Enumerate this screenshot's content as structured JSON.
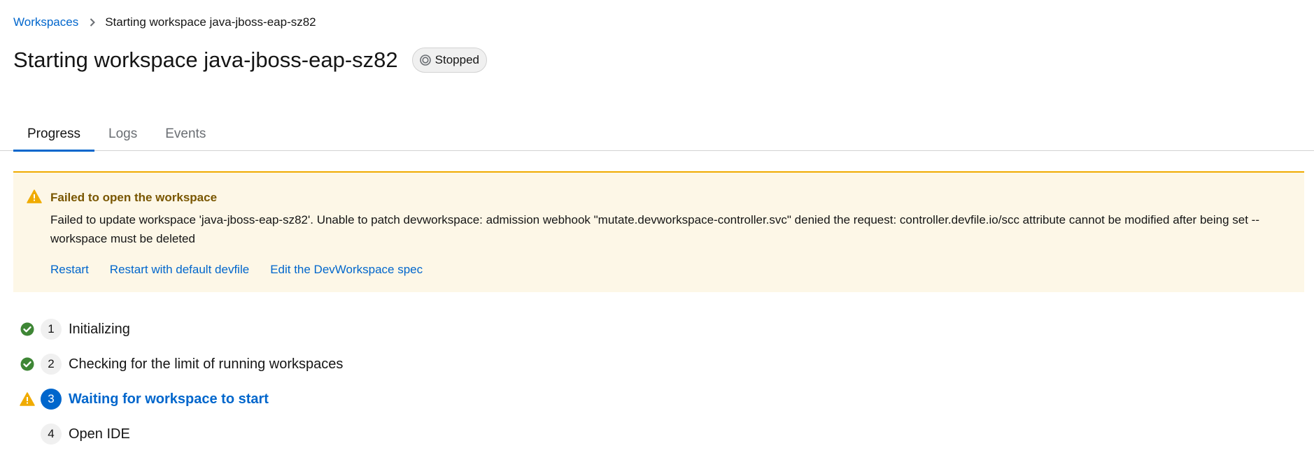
{
  "breadcrumb": {
    "root_label": "Workspaces",
    "current_label": "Starting workspace java-jboss-eap-sz82"
  },
  "header": {
    "title": "Starting workspace java-jboss-eap-sz82",
    "status_label": "Stopped"
  },
  "tabs": [
    {
      "label": "Progress",
      "active": true
    },
    {
      "label": "Logs",
      "active": false
    },
    {
      "label": "Events",
      "active": false
    }
  ],
  "alert": {
    "title": "Failed to open the workspace",
    "description": "Failed to update workspace 'java-jboss-eap-sz82'. Unable to patch devworkspace: admission webhook \"mutate.devworkspace-controller.svc\" denied the request: controller.devfile.io/scc attribute cannot be modified after being set -- workspace must be deleted",
    "actions": [
      {
        "label": "Restart"
      },
      {
        "label": "Restart with default devfile"
      },
      {
        "label": "Edit the DevWorkspace spec"
      }
    ],
    "icon": "warning-triangle-icon"
  },
  "steps": [
    {
      "number": "1",
      "label": "Initializing",
      "status": "done",
      "icon": "check-circle-icon"
    },
    {
      "number": "2",
      "label": "Checking for the limit of running workspaces",
      "status": "done",
      "icon": "check-circle-icon"
    },
    {
      "number": "3",
      "label": "Waiting for workspace to start",
      "status": "warning",
      "icon": "warning-triangle-icon"
    },
    {
      "number": "4",
      "label": "Open IDE",
      "status": "pending",
      "icon": ""
    }
  ],
  "colors": {
    "link": "#0066cc",
    "success": "#3e8635",
    "warning": "#f0ab00",
    "alert_bg": "#fdf7e7",
    "alert_title": "#795600"
  }
}
